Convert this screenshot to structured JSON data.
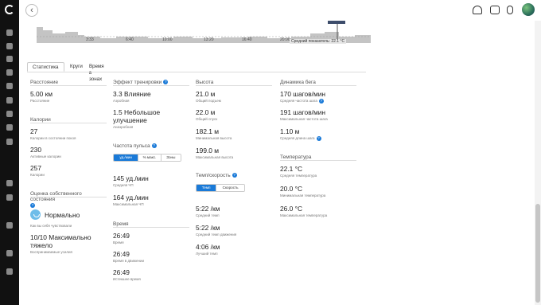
{
  "topbar": {
    "back_icon": "chevron-left-icon",
    "icons": [
      "upload-icon",
      "inbox-icon",
      "watch-icon"
    ]
  },
  "rail": {
    "icons": [
      "logo-icon",
      "home-icon",
      "chart-icon",
      "calendar-icon",
      "target-icon",
      "runner-icon",
      "heart-icon",
      "bars-icon",
      "medal-icon",
      "pulse-icon",
      "group-icon",
      "group2-icon",
      "trophy-icon",
      "settings-icon",
      "info-icon"
    ]
  },
  "chart": {
    "ticks": [
      "3:33",
      "6:40",
      "10:00",
      "13:20",
      "16:40",
      "20:00"
    ],
    "tooltip": "Средний показатель: 22.1 °C",
    "area_color": "#c4c4c4",
    "marker_color": "#555555"
  },
  "tabs": [
    {
      "label": "Статистика",
      "active": true
    },
    {
      "label": "Круги",
      "active": false
    },
    {
      "label": "Время в зонах",
      "active": false
    }
  ],
  "col1": {
    "distance_title": "Расстояние",
    "distance_value": "5.00 км",
    "distance_sub": "Расстояние",
    "calories_title": "Калории",
    "cal_rest_value": "27",
    "cal_rest_sub": "Калории в состоянии покоя",
    "cal_active_value": "230",
    "cal_active_sub": "Активные калории",
    "cal_total_value": "257",
    "cal_total_sub": "Калории",
    "selfeval_title": "Оценка собственного состояния",
    "feel_value": "Нормально",
    "feel_sub": "Как вы себя чувствовали",
    "effort_value": "10/10 Максимально тяжело",
    "effort_sub": "Воспринимаемые усилия"
  },
  "col2": {
    "effect_title": "Эффект тренировки",
    "aerobic_value": "3.3 Влияние",
    "aerobic_sub": "Аэробная",
    "anaerobic_value": "1.5 Небольшое улучшение",
    "anaerobic_sub": "Анаэробная",
    "hr_title": "Частота пульса",
    "hr_seg": [
      "уд./мин",
      "% макс.",
      "Зоны"
    ],
    "avg_hr_value": "145 уд./мин",
    "avg_hr_sub": "Средняя ЧП",
    "max_hr_value": "164 уд./мин",
    "max_hr_sub": "Максимальная ЧП",
    "time_title": "Время",
    "time_value": "26:49",
    "time_sub": "Время",
    "moving_value": "26:49",
    "moving_sub": "Время в движении",
    "elapsed_value": "26:49",
    "elapsed_sub": "Истекшее время"
  },
  "col3": {
    "elev_title": "Высота",
    "gain_value": "21.0 м",
    "gain_sub": "Общий подъем",
    "loss_value": "22.0 м",
    "loss_sub": "Общий спуск",
    "min_value": "182.1 м",
    "min_sub": "Минимальная высота",
    "max_value": "199.0 м",
    "max_sub": "Максимальная высота",
    "pace_title": "Темп/скорость",
    "pace_seg": [
      "Темп",
      "Скорость"
    ],
    "avg_pace_value": "5:22 /км",
    "avg_pace_sub": "Средний темп",
    "moving_pace_value": "5:22 /км",
    "moving_pace_sub": "Средний темп движения",
    "best_pace_value": "4:06 /км",
    "best_pace_sub": "Лучший темп"
  },
  "col4": {
    "dyn_title": "Динамика бега",
    "cad_avg_value": "170 шагов/мин",
    "cad_avg_sub": "Средняя частота шага",
    "cad_max_value": "191 шагов/мин",
    "cad_max_sub": "Максимальная частота шага",
    "stride_value": "1.10 м",
    "stride_sub": "Средняя длина шага",
    "temp_title": "Температура",
    "temp_avg_value": "22.1 °C",
    "temp_avg_sub": "Средняя температура",
    "temp_min_value": "20.0 °C",
    "temp_min_sub": "Минимальная температура",
    "temp_max_value": "26.0 °C",
    "temp_max_sub": "Максимальная температура"
  },
  "accent_color": "#1a7ad8"
}
